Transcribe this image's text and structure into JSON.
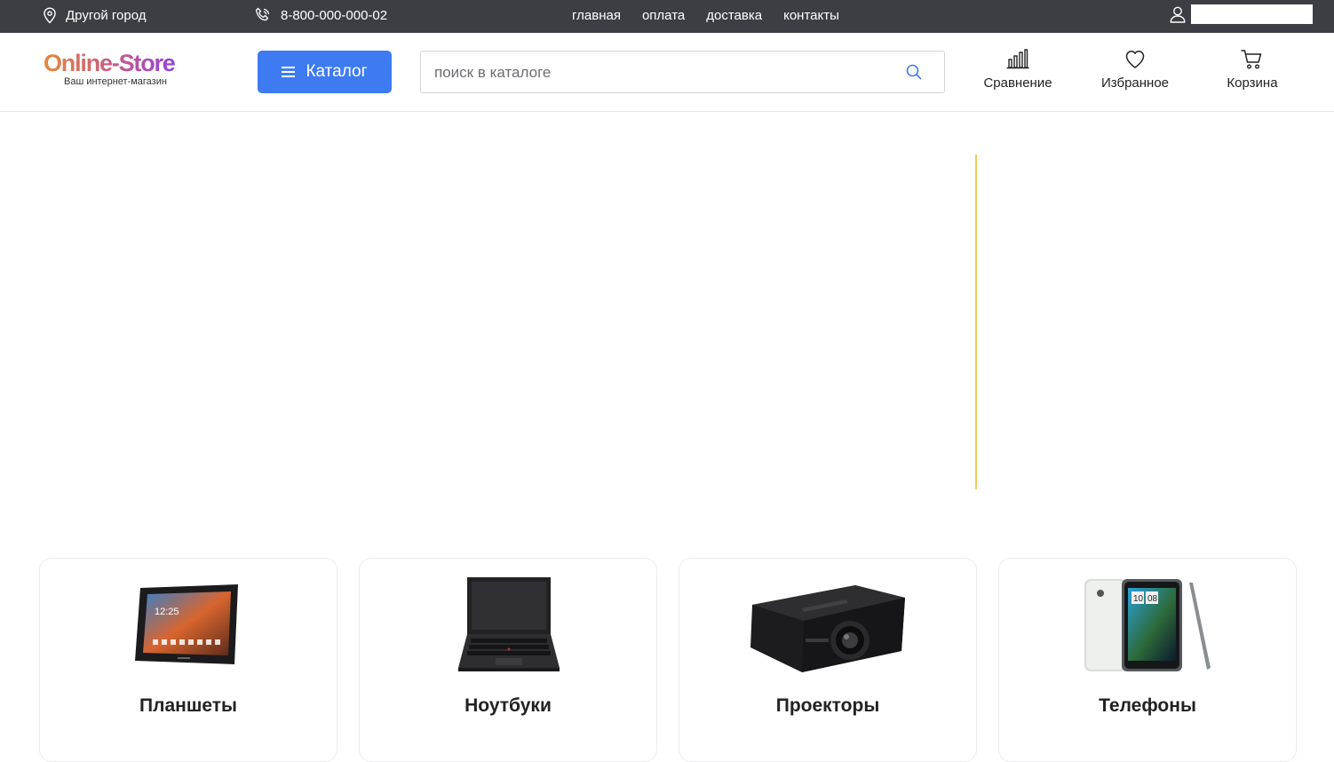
{
  "topbar": {
    "city": "Другой город",
    "phone": "8-800-000-000-02",
    "nav": [
      {
        "label": "главная"
      },
      {
        "label": "оплата"
      },
      {
        "label": "доставка"
      },
      {
        "label": "контакты"
      }
    ]
  },
  "logo": {
    "brand": "Online-Store",
    "tagline": "Ваш интернет-магазин"
  },
  "header": {
    "catalog_label": "Каталог",
    "search_placeholder": "поиск в каталоге",
    "compare_label": "Сравнение",
    "favorites_label": "Избранное",
    "cart_label": "Корзина"
  },
  "categories": [
    {
      "title": "Планшеты",
      "icon": "tablet-image"
    },
    {
      "title": "Ноутбуки",
      "icon": "laptop-image"
    },
    {
      "title": "Проекторы",
      "icon": "projector-image"
    },
    {
      "title": "Телефоны",
      "icon": "phone-image"
    }
  ],
  "colors": {
    "topbar_bg": "#3d3e44",
    "accent": "#3e7bf2",
    "hero_line": "#f0c75a"
  }
}
